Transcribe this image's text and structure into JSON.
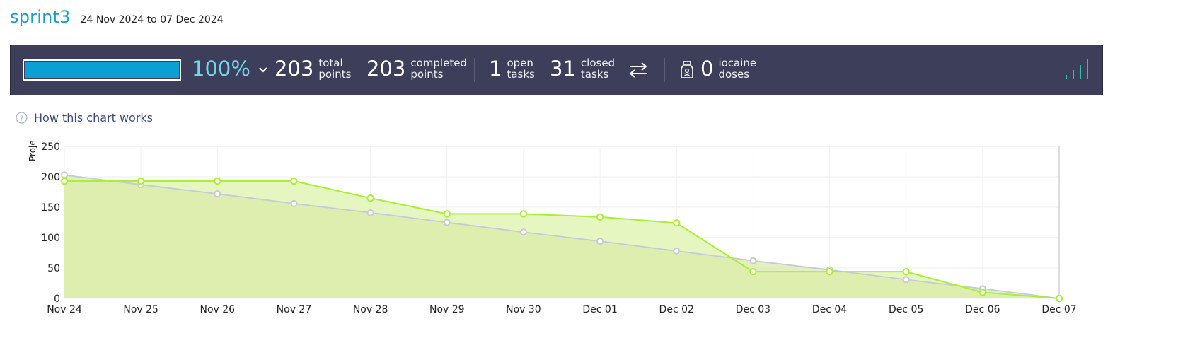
{
  "sprint": {
    "name": "sprint3",
    "date_range": "24 Nov 2024 to 07 Dec 2024"
  },
  "stats": {
    "progress_percent": 100,
    "progress_label": "100%",
    "total_points": "203",
    "total_points_label": [
      "total",
      "points"
    ],
    "completed_points": "203",
    "completed_points_label": [
      "completed",
      "points"
    ],
    "open_tasks": "1",
    "open_tasks_label": [
      "open",
      "tasks"
    ],
    "closed_tasks": "31",
    "closed_tasks_label": [
      "closed",
      "tasks"
    ],
    "iocaine_doses": "0",
    "iocaine_label": [
      "iocaine",
      "doses"
    ]
  },
  "icons": {
    "expand": "chevron-down-icon",
    "swap": "swap-arrows-icon",
    "iocaine": "poison-jar-icon",
    "graph_toggle": "signal-bars-icon",
    "help": "question-circle-icon"
  },
  "help": {
    "label": "How this chart works"
  },
  "colors": {
    "accent": "#0aa0d3",
    "stats_bar_bg": "#3d3e5a",
    "percent": "#6fd6ee",
    "actual_line": "#a7f032",
    "actual_fill": "#e3f5b9",
    "ideal_line": "#c5c9dc",
    "ideal_fill": "#d9eba8"
  },
  "chart_data": {
    "type": "area",
    "ylabel": "Proje",
    "ylim": [
      0,
      250
    ],
    "yticks": [
      0,
      50,
      100,
      150,
      200,
      250
    ],
    "categories": [
      "Nov 24",
      "Nov 25",
      "Nov 26",
      "Nov 27",
      "Nov 28",
      "Nov 29",
      "Nov 30",
      "Dec 01",
      "Dec 02",
      "Dec 03",
      "Dec 04",
      "Dec 05",
      "Dec 06",
      "Dec 07"
    ],
    "grid": true,
    "series": [
      {
        "values": [
          203,
          187,
          172,
          156,
          141,
          125,
          109,
          94,
          78,
          62,
          47,
          31,
          16,
          0
        ],
        "line_color": "#c5c9dc",
        "point_color": "#c8cad4",
        "fill_color": "#d9eba8"
      },
      {
        "values": [
          193,
          193,
          193,
          193,
          165,
          139,
          139,
          134,
          124,
          44,
          44,
          44,
          10,
          0
        ],
        "line_color": "#a7f032",
        "point_color": "#a7f032",
        "fill_color": "#e3f5b9"
      }
    ]
  }
}
